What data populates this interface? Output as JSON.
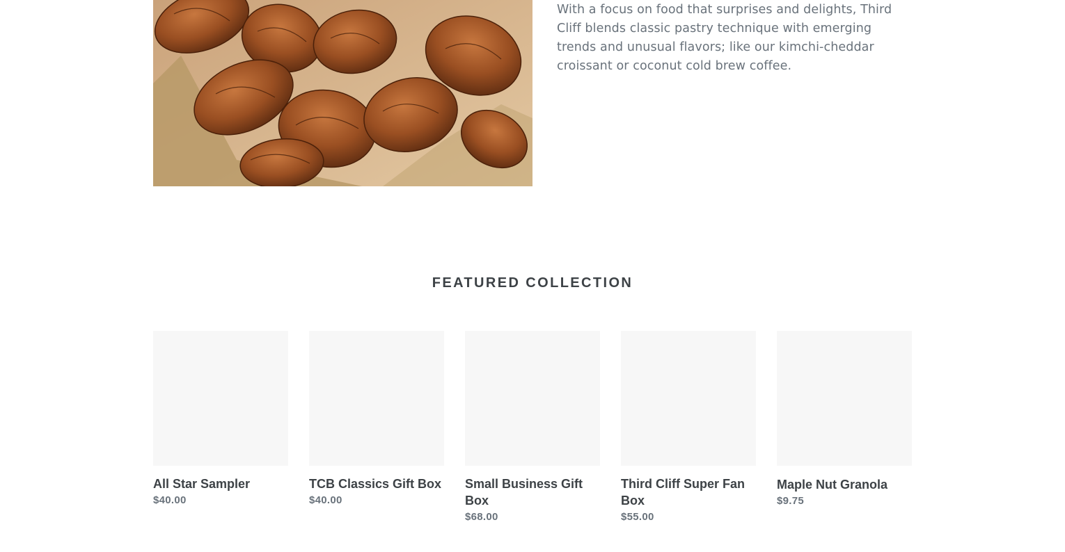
{
  "about": {
    "image_alt": "croissants-photo",
    "text": "With a focus on food that surprises and delights, Third Cliff blends classic pastry technique with emerging trends and unusual flavors; like our kimchi-cheddar croissant or coconut cold brew coffee."
  },
  "featured": {
    "title": "FEATURED COLLECTION",
    "products": [
      {
        "title": "All Star Sampler",
        "price": "$40.00"
      },
      {
        "title": "TCB Classics Gift Box",
        "price": "$40.00"
      },
      {
        "title": "Small Business Gift Box",
        "price": "$68.00"
      },
      {
        "title": "Third Cliff Super Fan Box",
        "price": "$55.00"
      },
      {
        "title": "Maple Nut Granola",
        "price": "$9.75"
      }
    ]
  },
  "colors": {
    "heading": "#3d4246",
    "body_text": "#69727b",
    "placeholder": "#f7f7f7"
  }
}
